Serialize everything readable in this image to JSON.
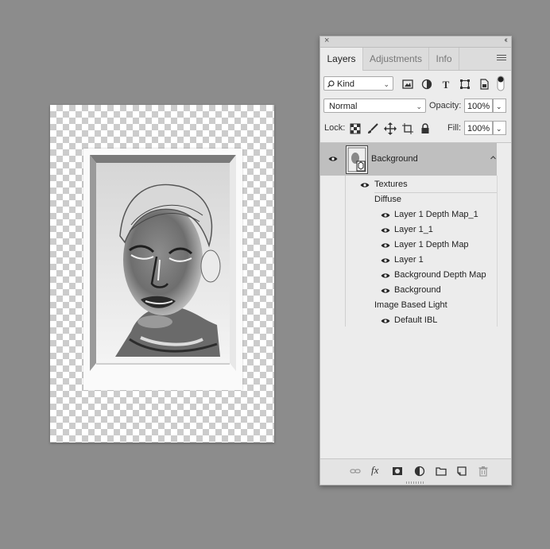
{
  "panel": {
    "close_glyph": "×",
    "collapse_glyph": "‹‹",
    "tabs": [
      {
        "label": "Layers",
        "active": true
      },
      {
        "label": "Adjustments",
        "active": false
      },
      {
        "label": "Info",
        "active": false
      }
    ],
    "filter": {
      "value": "Kind",
      "icons": [
        "search-icon",
        "image-filter-icon",
        "adjustment-filter-icon",
        "type-filter-icon",
        "shape-filter-icon",
        "smart-object-filter-icon",
        "filter-toggle-icon"
      ]
    },
    "blend": {
      "value": "Normal"
    },
    "opacity": {
      "label": "Opacity:",
      "value": "100%"
    },
    "lock": {
      "label": "Lock:",
      "icons": [
        "lock-transparency-icon",
        "lock-paint-icon",
        "lock-move-icon",
        "lock-artboard-icon",
        "lock-all-icon"
      ]
    },
    "fill": {
      "label": "Fill:",
      "value": "100%"
    },
    "layer": {
      "name": "Background",
      "visible": true
    },
    "tree": [
      {
        "label": "Textures",
        "indent": 1,
        "eye": true
      },
      {
        "label": "Diffuse",
        "indent": 2,
        "eye": false
      },
      {
        "label": "Layer 1 Depth Map_1",
        "indent": 3,
        "eye": true
      },
      {
        "label": "Layer 1_1",
        "indent": 3,
        "eye": true
      },
      {
        "label": "Layer 1 Depth Map",
        "indent": 3,
        "eye": true
      },
      {
        "label": "Layer 1",
        "indent": 3,
        "eye": true
      },
      {
        "label": "Background Depth Map",
        "indent": 3,
        "eye": true
      },
      {
        "label": "Background",
        "indent": 3,
        "eye": true
      },
      {
        "label": "Image Based Light",
        "indent": 2,
        "eye": false
      },
      {
        "label": "Default IBL",
        "indent": 3,
        "eye": true
      }
    ],
    "footer_icons": [
      "link-layers-icon",
      "fx-icon",
      "add-mask-icon",
      "adjustment-layer-icon",
      "new-group-icon",
      "new-layer-icon",
      "delete-icon"
    ],
    "fx_label": "fx"
  },
  "colors": {
    "app_bg": "#8c8c8c",
    "panel_bg": "#ececec",
    "selected_layer": "#bfbfbf"
  }
}
